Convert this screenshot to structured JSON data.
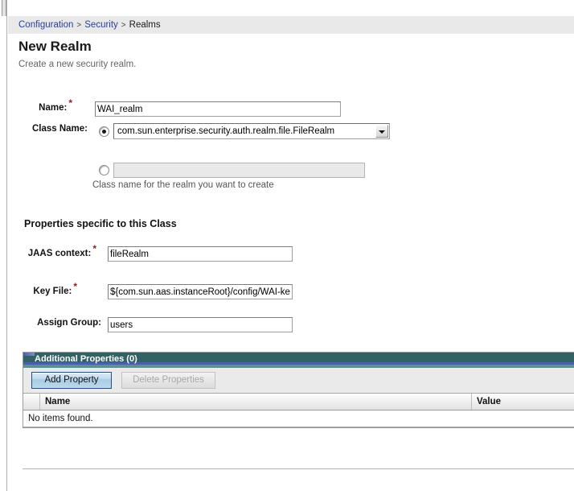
{
  "breadcrumb": {
    "items": [
      {
        "label": "Configuration",
        "link": true
      },
      {
        "label": "Security",
        "link": true
      },
      {
        "label": "Realms",
        "link": false
      }
    ],
    "separator": ">"
  },
  "page": {
    "title": "New Realm",
    "subtitle": "Create a new security realm."
  },
  "form": {
    "name": {
      "label": "Name:",
      "required_marker": "*",
      "value": "WAI_realm"
    },
    "class_name": {
      "label": "Class Name:",
      "selected_option": "com.sun.enterprise.security.auth.realm.file.FileRealm",
      "custom_value": "",
      "custom_placeholder": "",
      "hint": "Class name for the realm you want to create",
      "mode": "preset"
    }
  },
  "properties_section": {
    "heading": "Properties specific to this Class",
    "fields": [
      {
        "label": "JAAS context:",
        "required_marker": "*",
        "value": "fileRealm"
      },
      {
        "label": "Key File:",
        "required_marker": "*",
        "value": "${com.sun.aas.instanceRoot}/config/WAI-keyfi"
      },
      {
        "label": "Assign Group:",
        "required_marker": "",
        "value": "users"
      }
    ]
  },
  "additional_properties": {
    "title": "Additional Properties (0)",
    "buttons": {
      "add": "Add Property",
      "delete": "Delete Properties"
    },
    "columns": [
      "",
      "Name",
      "Value"
    ],
    "empty_message": "No items found.",
    "rows": []
  },
  "colors": {
    "panel_header": "#336265",
    "panel_header_accent": "#4a5fa5",
    "link": "#2a3f9d",
    "required_star": "#8c2323",
    "button_primary_border": "#2a4f7a"
  }
}
